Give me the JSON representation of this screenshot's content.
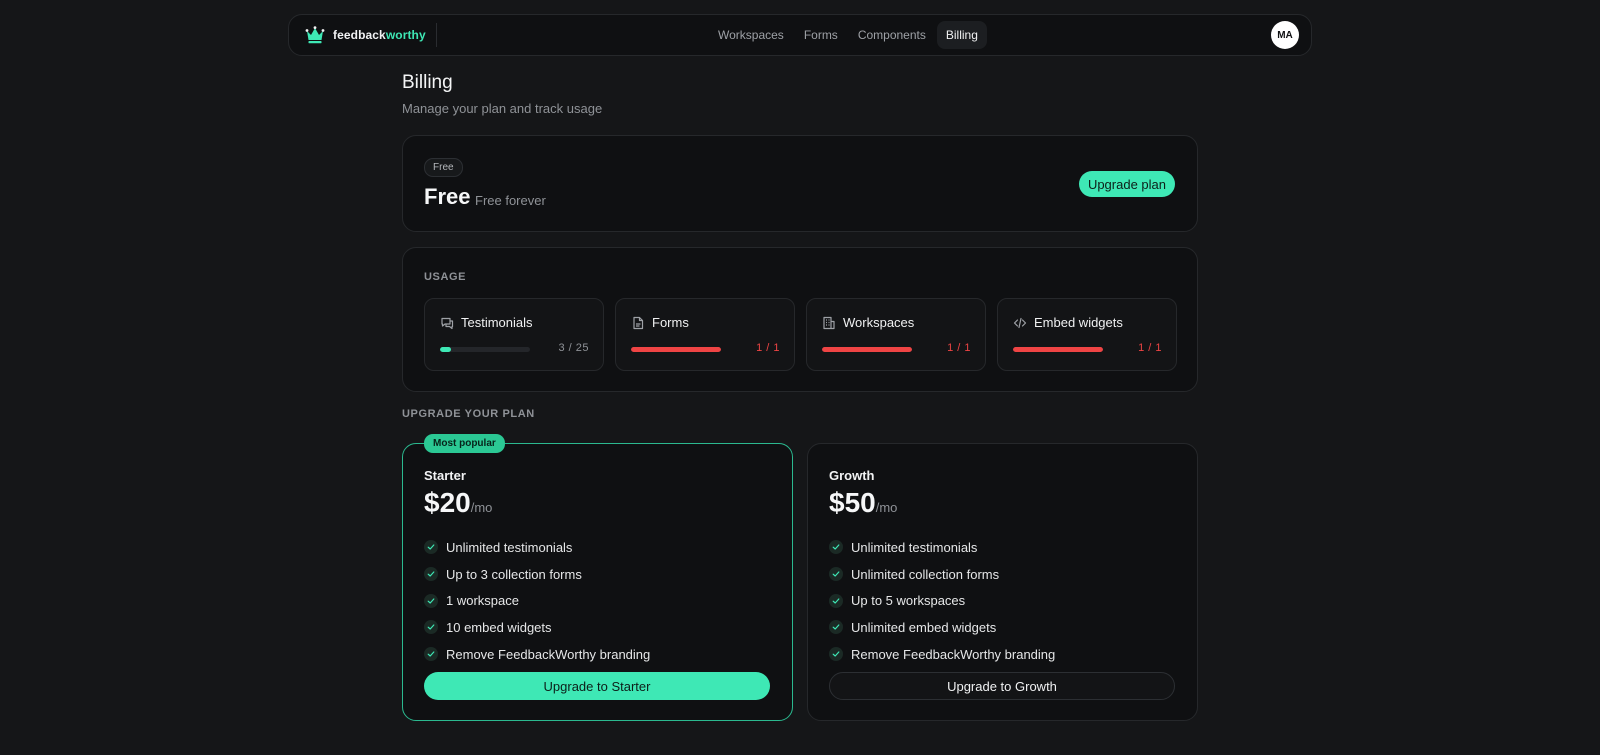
{
  "colors": {
    "accent": "#3ee8b5",
    "danger": "#ef4444",
    "background": "#151618",
    "card": "#0f1012"
  },
  "header": {
    "brand_part1": "feedback",
    "brand_part2": "worthy",
    "logo_icon": "crown-icon",
    "nav": [
      {
        "label": "Workspaces",
        "active": false
      },
      {
        "label": "Forms",
        "active": false
      },
      {
        "label": "Components",
        "active": false
      },
      {
        "label": "Billing",
        "active": true
      }
    ],
    "avatar_initials": "MA"
  },
  "page": {
    "title": "Billing",
    "subtitle": "Manage your plan and track usage"
  },
  "current_plan": {
    "badge": "Free",
    "name": "Free",
    "description": "Free forever",
    "upgrade_button": "Upgrade plan"
  },
  "usage": {
    "label": "USAGE",
    "items": [
      {
        "name": "Testimonials",
        "icon": "message-icon",
        "used": 3,
        "limit": 25,
        "count_text": "3 / 25",
        "status": "ok"
      },
      {
        "name": "Forms",
        "icon": "file-icon",
        "used": 1,
        "limit": 1,
        "count_text": "1 / 1",
        "status": "full"
      },
      {
        "name": "Workspaces",
        "icon": "building-icon",
        "used": 1,
        "limit": 1,
        "count_text": "1 / 1",
        "status": "full"
      },
      {
        "name": "Embed widgets",
        "icon": "code-icon",
        "used": 1,
        "limit": 1,
        "count_text": "1 / 1",
        "status": "full"
      }
    ]
  },
  "upgrade": {
    "label": "UPGRADE YOUR PLAN",
    "tiers": [
      {
        "name": "Starter",
        "badge": "Most popular",
        "price": "$20",
        "period": "/mo",
        "features": [
          "Unlimited testimonials",
          "Up to 3 collection forms",
          "1 workspace",
          "10 embed widgets",
          "Remove FeedbackWorthy branding"
        ],
        "button": "Upgrade to Starter"
      },
      {
        "name": "Growth",
        "price": "$50",
        "period": "/mo",
        "features": [
          "Unlimited testimonials",
          "Unlimited collection forms",
          "Up to 5 workspaces",
          "Unlimited embed widgets",
          "Remove FeedbackWorthy branding"
        ],
        "button": "Upgrade to Growth"
      }
    ]
  }
}
